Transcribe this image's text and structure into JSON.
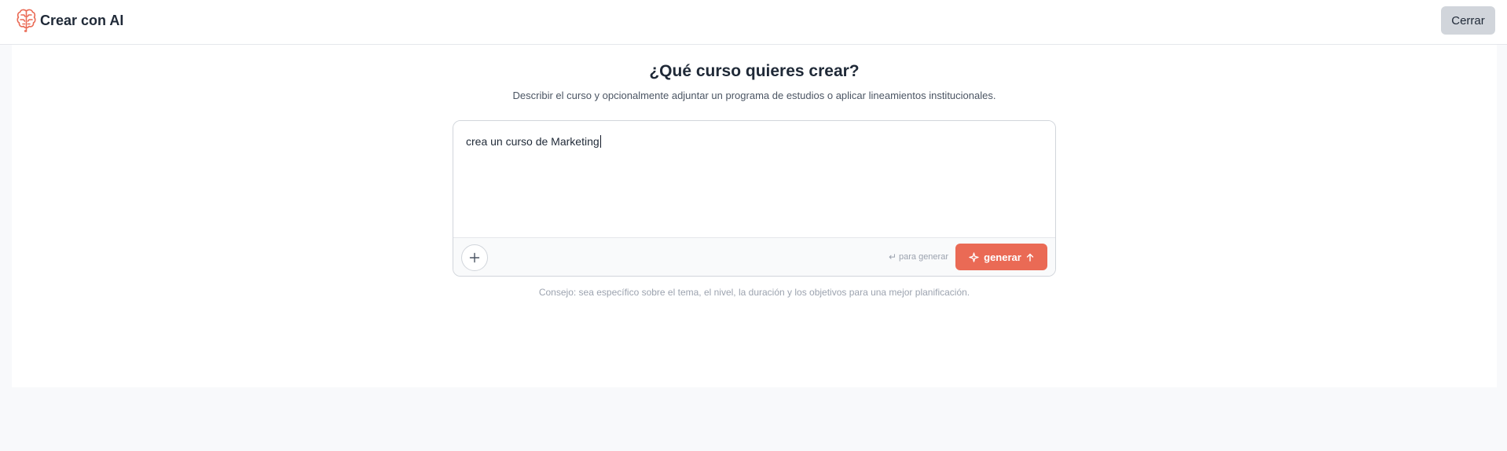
{
  "header": {
    "title": "Crear con AI",
    "logo_icon": "brain-icon",
    "close_label": "Cerrar"
  },
  "main": {
    "heading": "¿Qué curso quieres crear?",
    "subheading": "Describir el curso y opcionalmente adjuntar un programa de estudios o aplicar lineamientos institucionales.",
    "prompt_value": "crea un curso de Marketing",
    "attach_icon": "plus-icon",
    "hint_icon": "return-icon",
    "hint_text": "para generar",
    "generate_label": "generar",
    "generate_icons": [
      "sparkle-icon",
      "arrow-up-icon"
    ],
    "tip": "Consejo: sea específico sobre el tema, el nivel, la duración y los objetivos para una mejor planificación."
  },
  "colors": {
    "accent": "#ea6a55",
    "page_background": "#f8f9fb",
    "close_button": "#d1d5db"
  }
}
